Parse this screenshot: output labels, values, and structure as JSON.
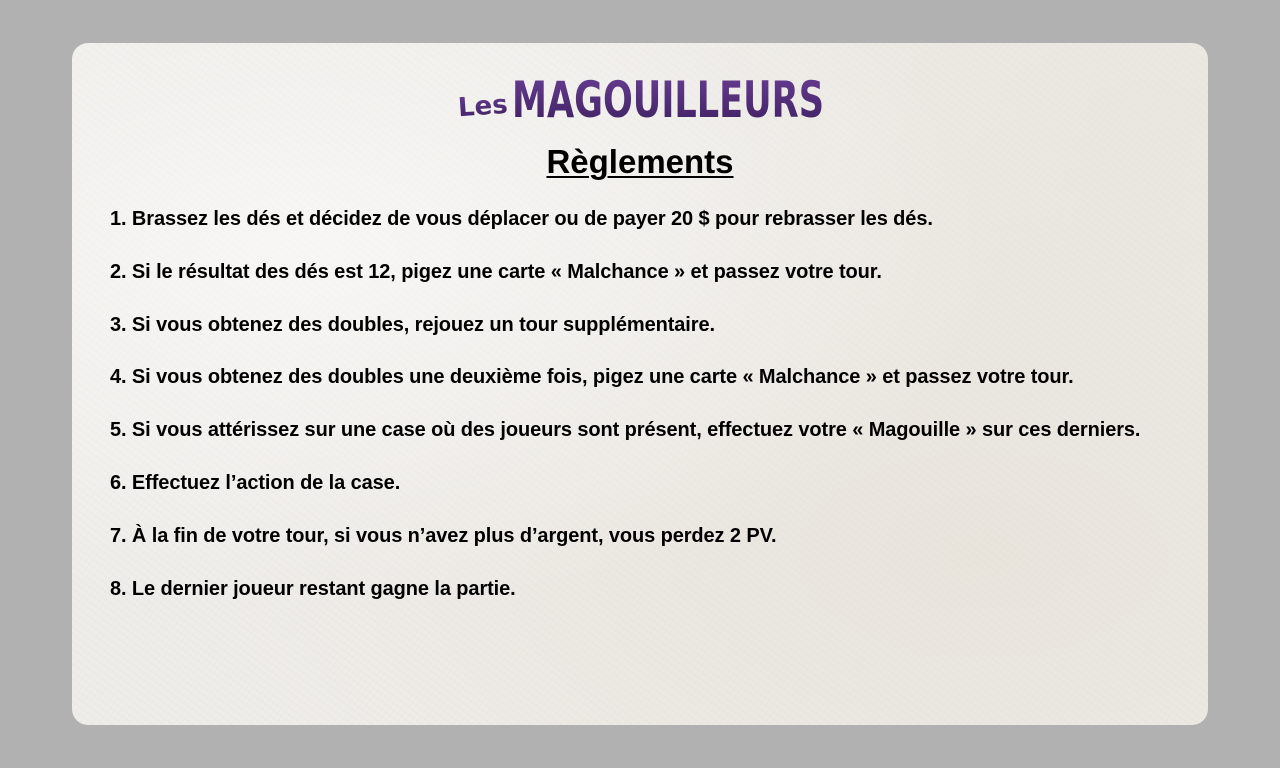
{
  "logo": {
    "text_small": "Les",
    "text_main": "MAGOUILLEURS",
    "color": "#4a2a6e"
  },
  "title": "Règlements",
  "rules": [
    "1. Brassez les dés et décidez de vous déplacer ou de payer 20 $ pour rebrasser les dés.",
    "2. Si le résultat des dés est 12, pigez une carte « Malchance » et passez votre tour.",
    "3. Si vous obtenez des doubles, rejouez un tour supplémentaire.",
    "4. Si vous obtenez des doubles une deuxième fois, pigez une carte « Malchance » et passez votre tour.",
    "5. Si vous attérissez sur une case où des joueurs sont présent, effectuez votre « Magouille » sur ces derniers.",
    "6. Effectuez l’action de la case.",
    "7. À la fin de votre tour, si vous n’avez plus d’argent, vous perdez 2 PV.",
    "8. Le dernier joueur restant gagne la partie."
  ]
}
